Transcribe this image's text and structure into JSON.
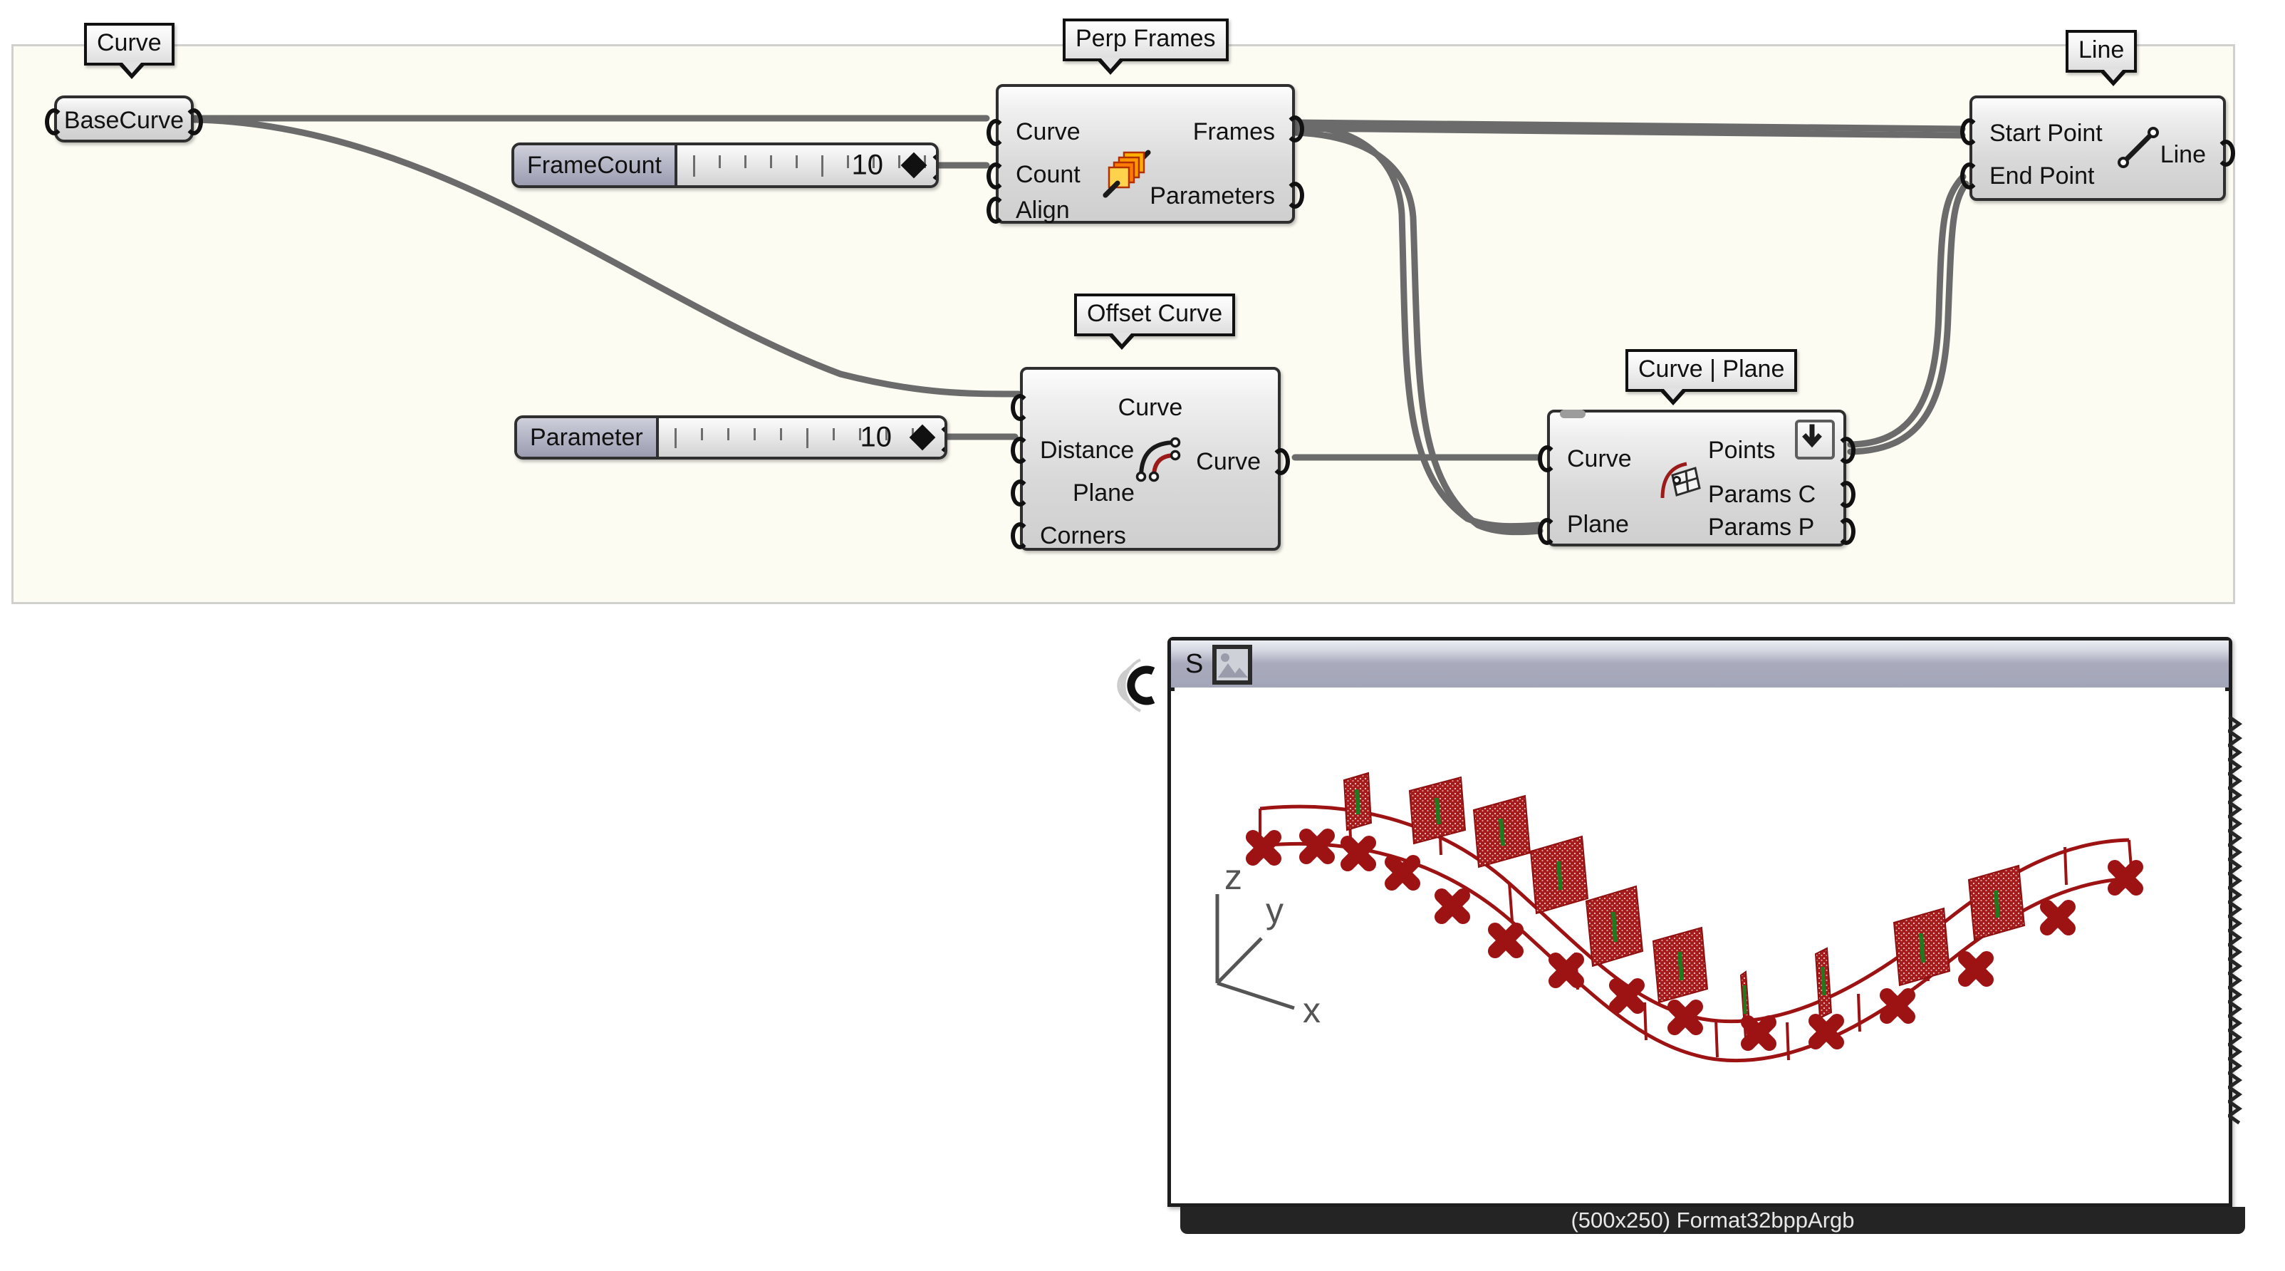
{
  "app": {
    "kind": "node-graph-editor",
    "canvas_background": "#fdfcf3",
    "group_border": "#d0d0cc",
    "wire_color": "#6b6b6b"
  },
  "tags": [
    {
      "id": "tag-curve",
      "label": "Curve"
    },
    {
      "id": "tag-perp-frames",
      "label": "Perp Frames"
    },
    {
      "id": "tag-line",
      "label": "Line"
    },
    {
      "id": "tag-offset-curve",
      "label": "Offset Curve"
    },
    {
      "id": "tag-curve-plane",
      "label": "Curve | Plane"
    }
  ],
  "params": {
    "base_curve": {
      "label": "BaseCurve"
    }
  },
  "sliders": [
    {
      "id": "framecount",
      "name": "FrameCount",
      "value": "10",
      "tick_count": 10,
      "handle": "diamond"
    },
    {
      "id": "parameter",
      "name": "Parameter",
      "value": "10",
      "tick_count": 10,
      "handle": "diamond"
    }
  ],
  "nodes": [
    {
      "id": "perp-frames",
      "title": "Perp Frames",
      "icon": "stacked-frames-icon",
      "inputs": [
        "Curve",
        "Count",
        "Align"
      ],
      "outputs": [
        "Frames",
        "Parameters"
      ]
    },
    {
      "id": "line",
      "title": "Line",
      "icon": "line-segment-icon",
      "inputs": [
        "Start Point",
        "End Point"
      ],
      "outputs": [
        "Line"
      ]
    },
    {
      "id": "offset-curve",
      "title": "Offset Curve",
      "icon": "offset-arc-icon",
      "inputs": [
        "Curve",
        "Distance",
        "Plane",
        "Corners"
      ],
      "outputs": [
        "Curve"
      ]
    },
    {
      "id": "curve-plane",
      "title": "Curve | Plane",
      "icon": "curve-plane-icon",
      "inputs": [
        "Curve",
        "Plane"
      ],
      "outputs": [
        "Points",
        "Params C",
        "Params P"
      ],
      "badge": "download-arrow-icon"
    }
  ],
  "preview_panel": {
    "header_label": "S",
    "header_icon": "picture-icon",
    "status_text": "(500x250) Format32bppArgb",
    "axis_gizmo": {
      "z": "z",
      "y": "y",
      "x": "x"
    },
    "geometry_color": "#9d1313",
    "frame_marker_color": "#a51a1a",
    "axis_highlight_color": "#1f7a1f",
    "point_marker": "x-cross",
    "frame_count": 16
  }
}
